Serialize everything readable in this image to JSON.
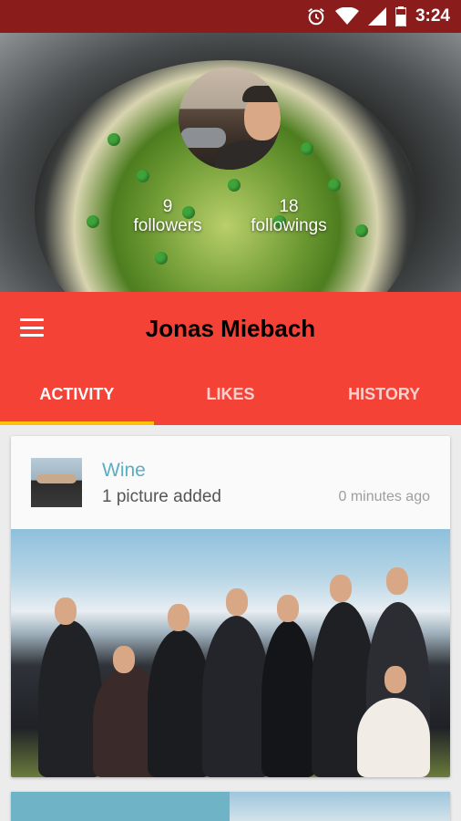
{
  "status_bar": {
    "time": "3:24",
    "icons": [
      "alarm-icon",
      "wifi-icon",
      "signal-icon",
      "battery-icon"
    ]
  },
  "profile": {
    "name": "Jonas Miebach",
    "followers_count": "9",
    "followers_label": "followers",
    "followings_count": "18",
    "followings_label": "followings"
  },
  "tabs": [
    {
      "label": "ACTIVITY",
      "active": true
    },
    {
      "label": "LIKES",
      "active": false
    },
    {
      "label": "HISTORY",
      "active": false
    }
  ],
  "activity": [
    {
      "title": "Wine",
      "subtitle": "1 picture added",
      "time": "0 minutes ago"
    }
  ],
  "colors": {
    "status_bar": "#8a1c1c",
    "app_bar": "#f44336",
    "tab_indicator": "#ffc107",
    "card_title": "#5aaec2"
  }
}
